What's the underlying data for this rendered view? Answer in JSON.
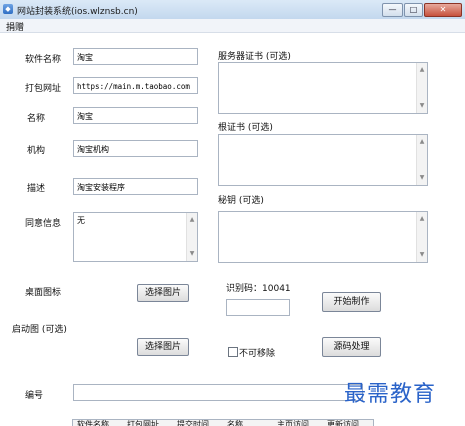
{
  "window": {
    "title": "网站封装系统(ios.wlznsb.cn)",
    "icon": "app-icon",
    "min": "—",
    "max": "□",
    "close": "✕"
  },
  "menu": {
    "items": [
      "捐赠"
    ]
  },
  "form": {
    "software_name": {
      "label": "软件名称",
      "value": "淘宝"
    },
    "package_url": {
      "label": "打包网址",
      "value": "https://main.m.taobao.com"
    },
    "name": {
      "label": "名称",
      "value": "淘宝"
    },
    "org": {
      "label": "机构",
      "value": "淘宝机构"
    },
    "desc": {
      "label": "描述",
      "value": "淘宝安装程序"
    },
    "consent": {
      "label": "同意信息",
      "value": "无"
    },
    "desktop_icon": {
      "label": "桌面图标",
      "button": "选择图片"
    },
    "launch_image": {
      "label": "启动图 (可选)",
      "button": "选择图片"
    },
    "number": {
      "label": "编号",
      "value": ""
    }
  },
  "right": {
    "server_cert": {
      "label": "服务器证书 (可选)"
    },
    "root_cert": {
      "label": "根证书 (可选)"
    },
    "secret_key": {
      "label": "秘钥 (可选)"
    },
    "id_code": {
      "label": "识别码：",
      "value": "10041"
    },
    "start_button": "开始制作",
    "non_removable": "不可移除",
    "source_button": "源码处理"
  },
  "table": {
    "columns": [
      "软件名称",
      "打包网址",
      "提交时间",
      "名称",
      "主页访问",
      "更新访问"
    ]
  },
  "watermark": "最需教育"
}
